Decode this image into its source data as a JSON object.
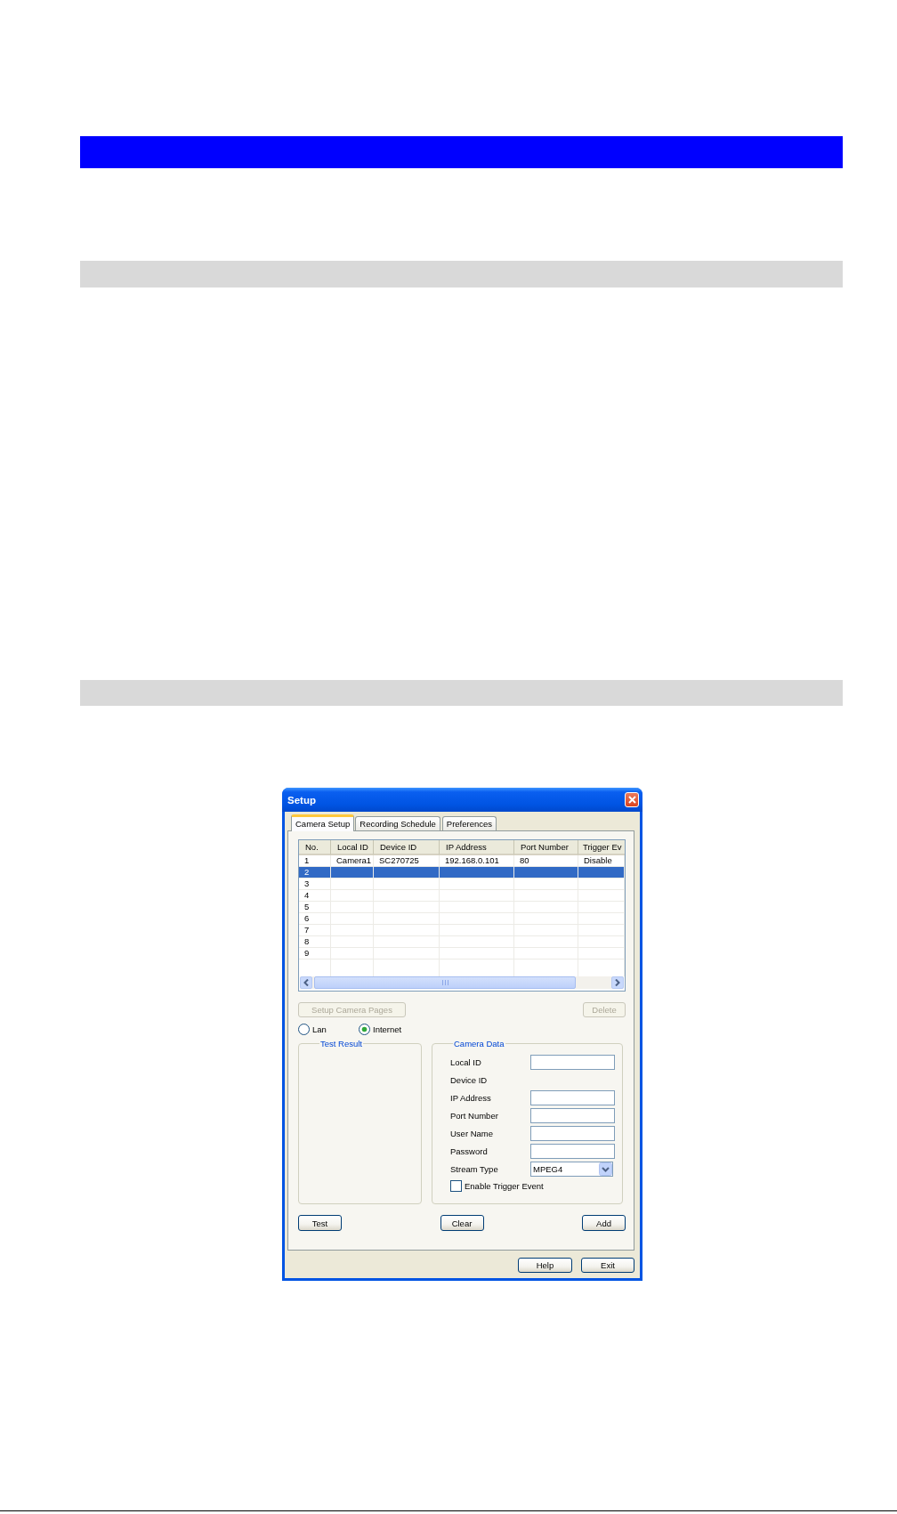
{
  "dialog": {
    "title": "Setup",
    "tabs": [
      {
        "label": "Camera Setup",
        "selected": true
      },
      {
        "label": "Recording Schedule",
        "selected": false
      },
      {
        "label": "Preferences",
        "selected": false
      }
    ],
    "camera_list": {
      "columns": [
        "No.",
        "Local ID",
        "Device ID",
        "IP Address",
        "Port Number",
        "Trigger Ev"
      ],
      "rows": [
        {
          "cells": [
            "1",
            "Camera1",
            "SC270725",
            "192.168.0.101",
            "80",
            "Disable"
          ],
          "selected": false
        },
        {
          "cells": [
            "2"
          ],
          "selected": true
        },
        {
          "cells": [
            "3"
          ],
          "selected": false
        },
        {
          "cells": [
            "4"
          ],
          "selected": false
        },
        {
          "cells": [
            "5"
          ],
          "selected": false
        },
        {
          "cells": [
            "6"
          ],
          "selected": false
        },
        {
          "cells": [
            "7"
          ],
          "selected": false
        },
        {
          "cells": [
            "8"
          ],
          "selected": false
        },
        {
          "cells": [
            "9"
          ],
          "selected": false
        }
      ]
    },
    "list_buttons": [
      {
        "label": "Setup Camera Pages",
        "disabled": true
      },
      {
        "label": "Delete",
        "disabled": true
      }
    ],
    "connection": [
      {
        "label": "Lan",
        "selected": false
      },
      {
        "label": "Internet",
        "selected": true
      }
    ],
    "test_result": {
      "title": "Test Result"
    },
    "camera_data": {
      "title": "Camera Data",
      "fields": [
        {
          "label": "Local ID",
          "kind": "input"
        },
        {
          "label": "Device ID",
          "kind": "text"
        },
        {
          "label": "IP Address",
          "kind": "input"
        },
        {
          "label": "Port Number",
          "kind": "input"
        },
        {
          "label": "User Name",
          "kind": "input"
        },
        {
          "label": "Password",
          "kind": "input"
        },
        {
          "label": "Stream Type",
          "kind": "select",
          "value": "MPEG4"
        }
      ],
      "trigger_event": {
        "label": "Enable Trigger Event",
        "checked": false
      }
    },
    "action_buttons": [
      "Test",
      "Clear",
      "Add"
    ],
    "footer_buttons": [
      "Help",
      "Exit"
    ]
  }
}
